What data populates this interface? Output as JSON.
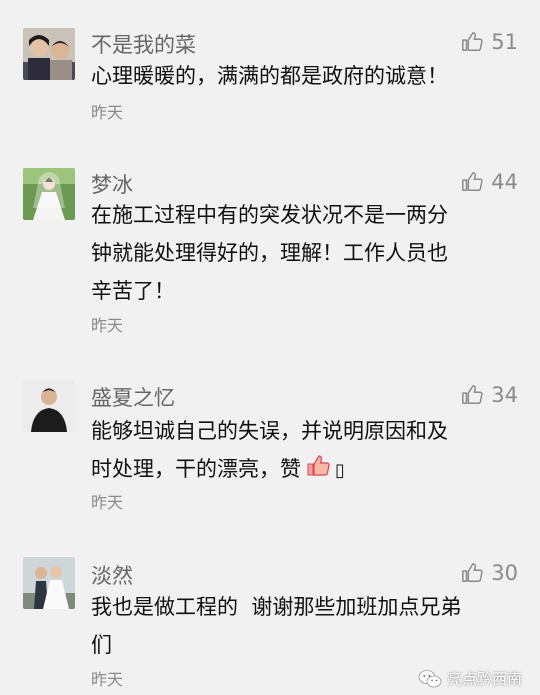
{
  "comments": [
    {
      "name": "不是我的菜",
      "likes": "51",
      "lines": [
        "心理暖暖的，满满的都是政府的诚意！"
      ],
      "time": "昨天",
      "avatar": "couple-photo-avatar"
    },
    {
      "name": "梦冰",
      "likes": "44",
      "lines": [
        "在施工过程中有的突发状况不是一两分",
        "钟就能处理得好的，理解！工作人员也",
        "辛苦了！"
      ],
      "time": "昨天",
      "avatar": "wedding-photo-avatar"
    },
    {
      "name": "盛夏之忆",
      "likes": "34",
      "lines": [
        "能够坦诚自己的失误，并说明原因和及",
        "时处理，干的漂亮，赞"
      ],
      "line_suffix": "▯",
      "time": "昨天",
      "avatar": "dark-portrait-avatar"
    },
    {
      "name": "淡然",
      "likes": "30",
      "lines": [
        "我也是做工程的  谢谢那些加班加点兄弟",
        "们"
      ],
      "time": "昨天",
      "avatar": "wedding-couple-avatar"
    }
  ],
  "icons": {
    "like": "thumbs-up-icon",
    "emoji": "thumbs-up-emoji-icon",
    "watermark": "wechat-logo-icon"
  },
  "watermark": {
    "text": "亮点黔西南"
  },
  "colors": {
    "background": "#f1f1f1",
    "name": "#666666",
    "content": "#111111",
    "meta": "#8a8a8a"
  }
}
